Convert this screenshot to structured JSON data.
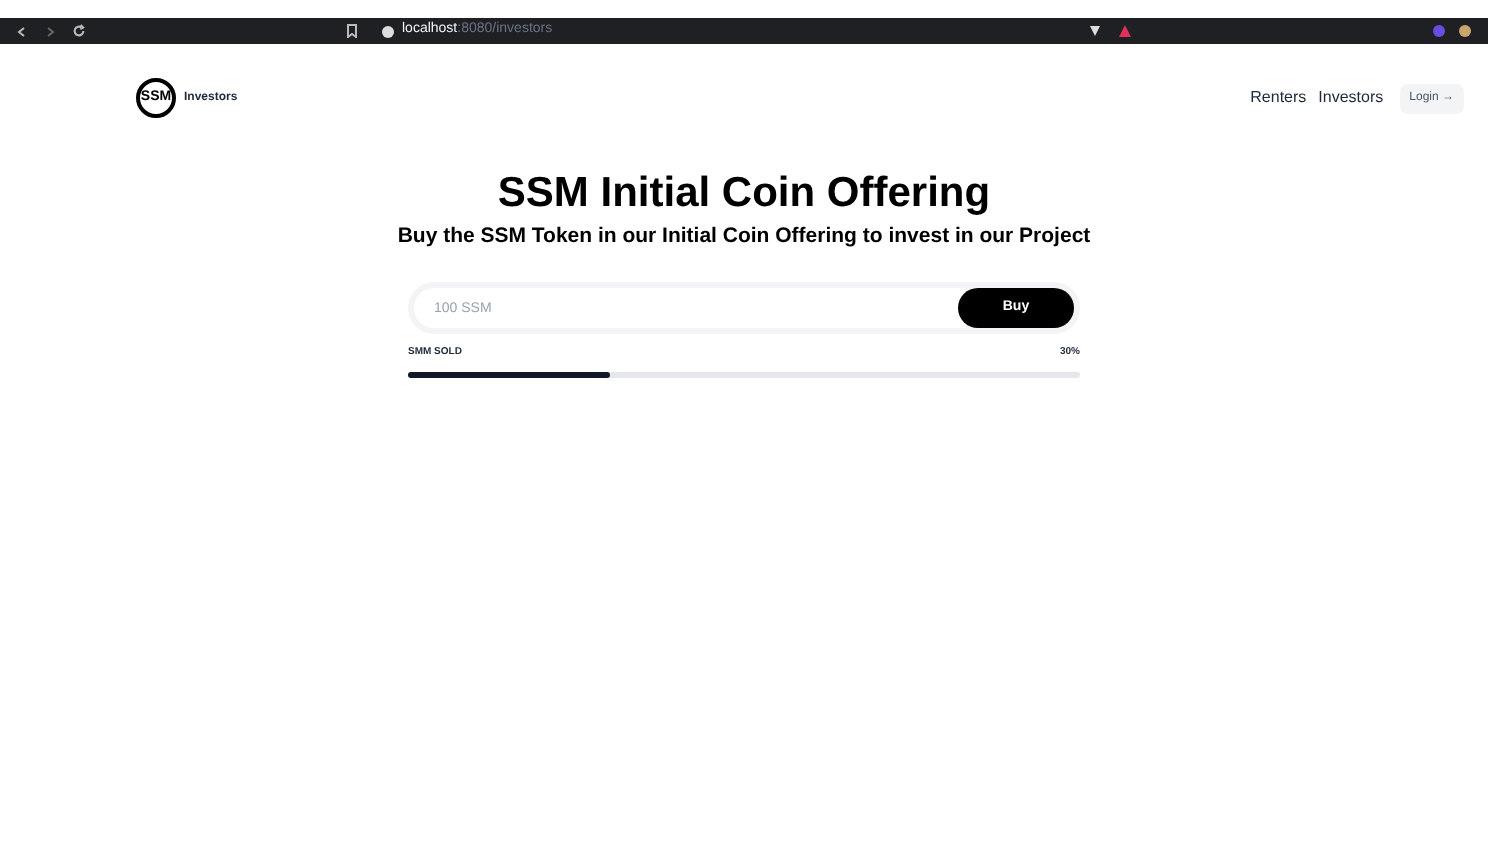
{
  "browser": {
    "url_host": "localhost",
    "url_path": ":8080/investors"
  },
  "header": {
    "logo": "SSM",
    "brand": "Investors",
    "nav": [
      {
        "label": "Renters"
      },
      {
        "label": "Investors"
      }
    ],
    "login": "Login →"
  },
  "hero": {
    "title": "SSM Initial Coin Offering",
    "subtitle": "Buy the SSM Token in our Initial Coin Offering to invest in our Project"
  },
  "purchase": {
    "placeholder": "100 SSM",
    "button": "Buy"
  },
  "progress": {
    "label": "SMM SOLD",
    "reading": "30%",
    "level": 0.3
  }
}
